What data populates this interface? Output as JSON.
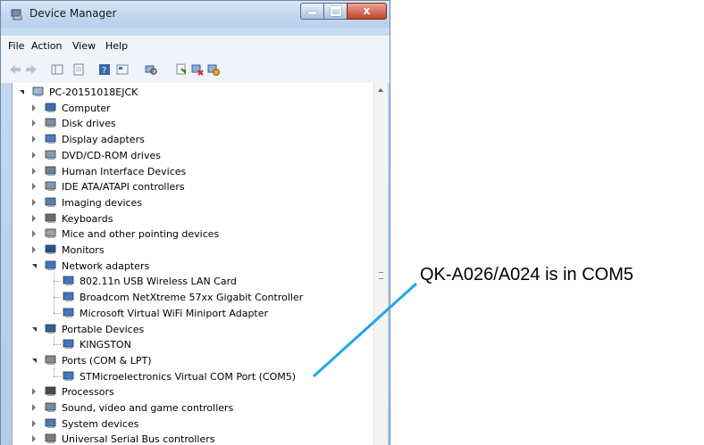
{
  "window": {
    "title": "Device Manager",
    "controls": {
      "minimize": "minimize",
      "maximize": "maximize",
      "close": "x"
    }
  },
  "menubar": {
    "items": [
      "File",
      "Action",
      "View",
      "Help"
    ]
  },
  "toolbar": {
    "buttons": [
      "back-icon",
      "forward-icon",
      "show-hide-tree-icon",
      "properties-icon",
      "help-icon",
      "view-icon",
      "scan-hardware-icon",
      "update-driver-icon",
      "uninstall-icon",
      "disable-icon"
    ]
  },
  "tree": {
    "root": "PC-20151018EJCK",
    "items": [
      {
        "label": "Computer",
        "icon": "computer-icon",
        "state": "collapsed"
      },
      {
        "label": "Disk drives",
        "icon": "disk-drive-icon",
        "state": "collapsed"
      },
      {
        "label": "Display adapters",
        "icon": "display-adapter-icon",
        "state": "collapsed"
      },
      {
        "label": "DVD/CD-ROM drives",
        "icon": "dvd-drive-icon",
        "state": "collapsed"
      },
      {
        "label": "Human Interface Devices",
        "icon": "hid-icon",
        "state": "collapsed"
      },
      {
        "label": "IDE ATA/ATAPI controllers",
        "icon": "ide-controller-icon",
        "state": "collapsed"
      },
      {
        "label": "Imaging devices",
        "icon": "imaging-icon",
        "state": "collapsed"
      },
      {
        "label": "Keyboards",
        "icon": "keyboard-icon",
        "state": "collapsed"
      },
      {
        "label": "Mice and other pointing devices",
        "icon": "mouse-icon",
        "state": "collapsed"
      },
      {
        "label": "Monitors",
        "icon": "monitor-icon",
        "state": "collapsed"
      },
      {
        "label": "Network adapters",
        "icon": "network-adapter-icon",
        "state": "expanded",
        "children": [
          "802.11n USB Wireless LAN Card",
          "Broadcom NetXtreme 57xx Gigabit Controller",
          "Microsoft Virtual WiFi Miniport Adapter"
        ]
      },
      {
        "label": "Portable Devices",
        "icon": "portable-device-icon",
        "state": "expanded",
        "children": [
          "KINGSTON"
        ]
      },
      {
        "label": "Ports (COM & LPT)",
        "icon": "port-icon",
        "state": "expanded",
        "children": [
          "STMicroelectronics Virtual COM Port (COM5)"
        ]
      },
      {
        "label": "Processors",
        "icon": "processor-icon",
        "state": "collapsed"
      },
      {
        "label": "Sound, video and game controllers",
        "icon": "sound-icon",
        "state": "collapsed"
      },
      {
        "label": "System devices",
        "icon": "system-device-icon",
        "state": "collapsed"
      },
      {
        "label": "Universal Serial Bus controllers",
        "icon": "usb-icon",
        "state": "collapsed"
      }
    ]
  },
  "annotation": {
    "text": "QK-A026/A024 is in COM5",
    "line_color": "#1ea7e8"
  }
}
